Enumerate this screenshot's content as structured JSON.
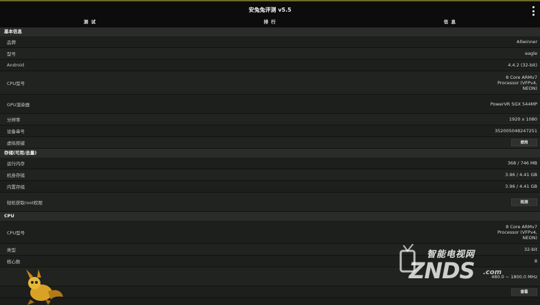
{
  "app": {
    "title": "安兔兔评测 v5.5"
  },
  "tabs": [
    {
      "label": "测 试"
    },
    {
      "label": "排 行"
    },
    {
      "label": "信 息"
    }
  ],
  "sections": {
    "basic": {
      "title": "基本信息",
      "rows": [
        {
          "label": "品牌",
          "value": "Allwinner"
        },
        {
          "label": "型号",
          "value": "eagle"
        },
        {
          "label": "Android",
          "value": "4.4.2 (32-bit)"
        },
        {
          "label": "CPU型号",
          "value": "8 Core ARMv7 Processor (VFPv4, NEON)"
        },
        {
          "label": "GPU渲染器",
          "value": "PowerVR SGX 544MP"
        },
        {
          "label": "分辨率",
          "value": "1920 x 1080"
        },
        {
          "label": "设备串号",
          "value": "352005048247251"
        },
        {
          "label": "虚拟按键",
          "button": "使用"
        }
      ]
    },
    "storage": {
      "title": "存储(可用/总量)",
      "rows": [
        {
          "label": "运行内存",
          "value": "368 / 746 MB"
        },
        {
          "label": "机身存储",
          "value": "3.96 / 4.41 GB"
        },
        {
          "label": "内置存储",
          "value": "3.96 / 4.41 GB"
        },
        {
          "label": "轻松获取root权限",
          "button": "检测"
        }
      ]
    },
    "cpu": {
      "title": "CPU",
      "rows": [
        {
          "label": "CPU型号",
          "value": "8 Core ARMv7 Processor (VFPv4, NEON)"
        },
        {
          "label": "类型",
          "value": "32-bit"
        },
        {
          "label": "核心数",
          "value": "8"
        },
        {
          "label": "",
          "value": "480.0 ~ 1800.0 MHz"
        },
        {
          "label": "",
          "button": "查看"
        }
      ]
    }
  },
  "watermark": {
    "cn": "智能电视网",
    "en": "ZNDS",
    "domain": ".com"
  }
}
